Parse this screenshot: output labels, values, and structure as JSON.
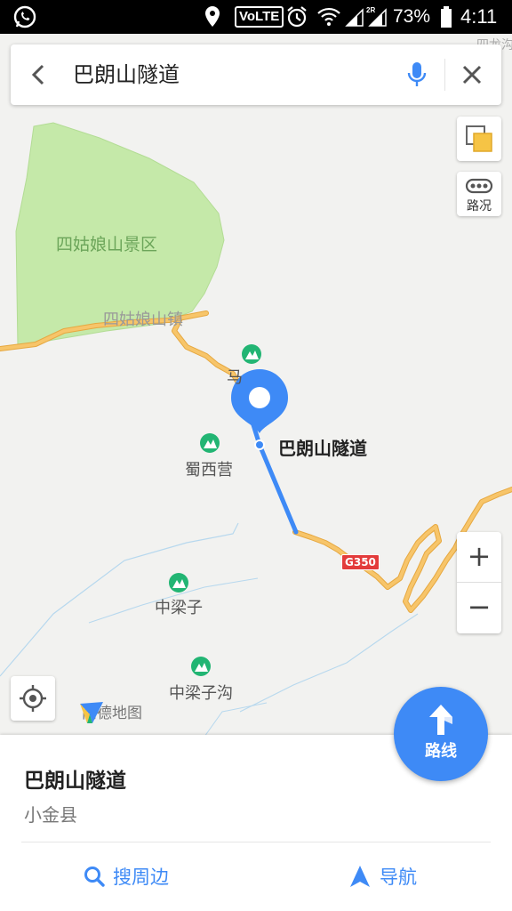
{
  "status_bar": {
    "volte": "VoLTE",
    "network_tag": "2R",
    "battery": "73%",
    "time": "4:11"
  },
  "search": {
    "query": "巴朗山隧道"
  },
  "map": {
    "labels": {
      "scenic_area": "四姑娘山景区",
      "town": "四姑娘山镇",
      "poi_ma": "马",
      "poi_shuxiying": "蜀西营",
      "poi_zhongliangzi": "中梁子",
      "poi_zhongliangzigou": "中梁子沟",
      "tunnel": "巴朗山隧道",
      "corner": "四龙沟",
      "road_shield": "G350"
    },
    "traffic_label": "路况",
    "zoom_in": "+",
    "zoom_out": "−",
    "logo_text": "高德地图"
  },
  "route_button": {
    "label": "路线"
  },
  "place": {
    "name": "巴朗山隧道",
    "region": "小金县"
  },
  "actions": {
    "nearby": "搜周边",
    "navigate": "导航"
  },
  "colors": {
    "accent": "#3e8af6",
    "road": "#f7c56a",
    "scenic_green": "#c5e9a9",
    "poi_green": "#22b573",
    "road_shield_red": "#e33b3b"
  }
}
